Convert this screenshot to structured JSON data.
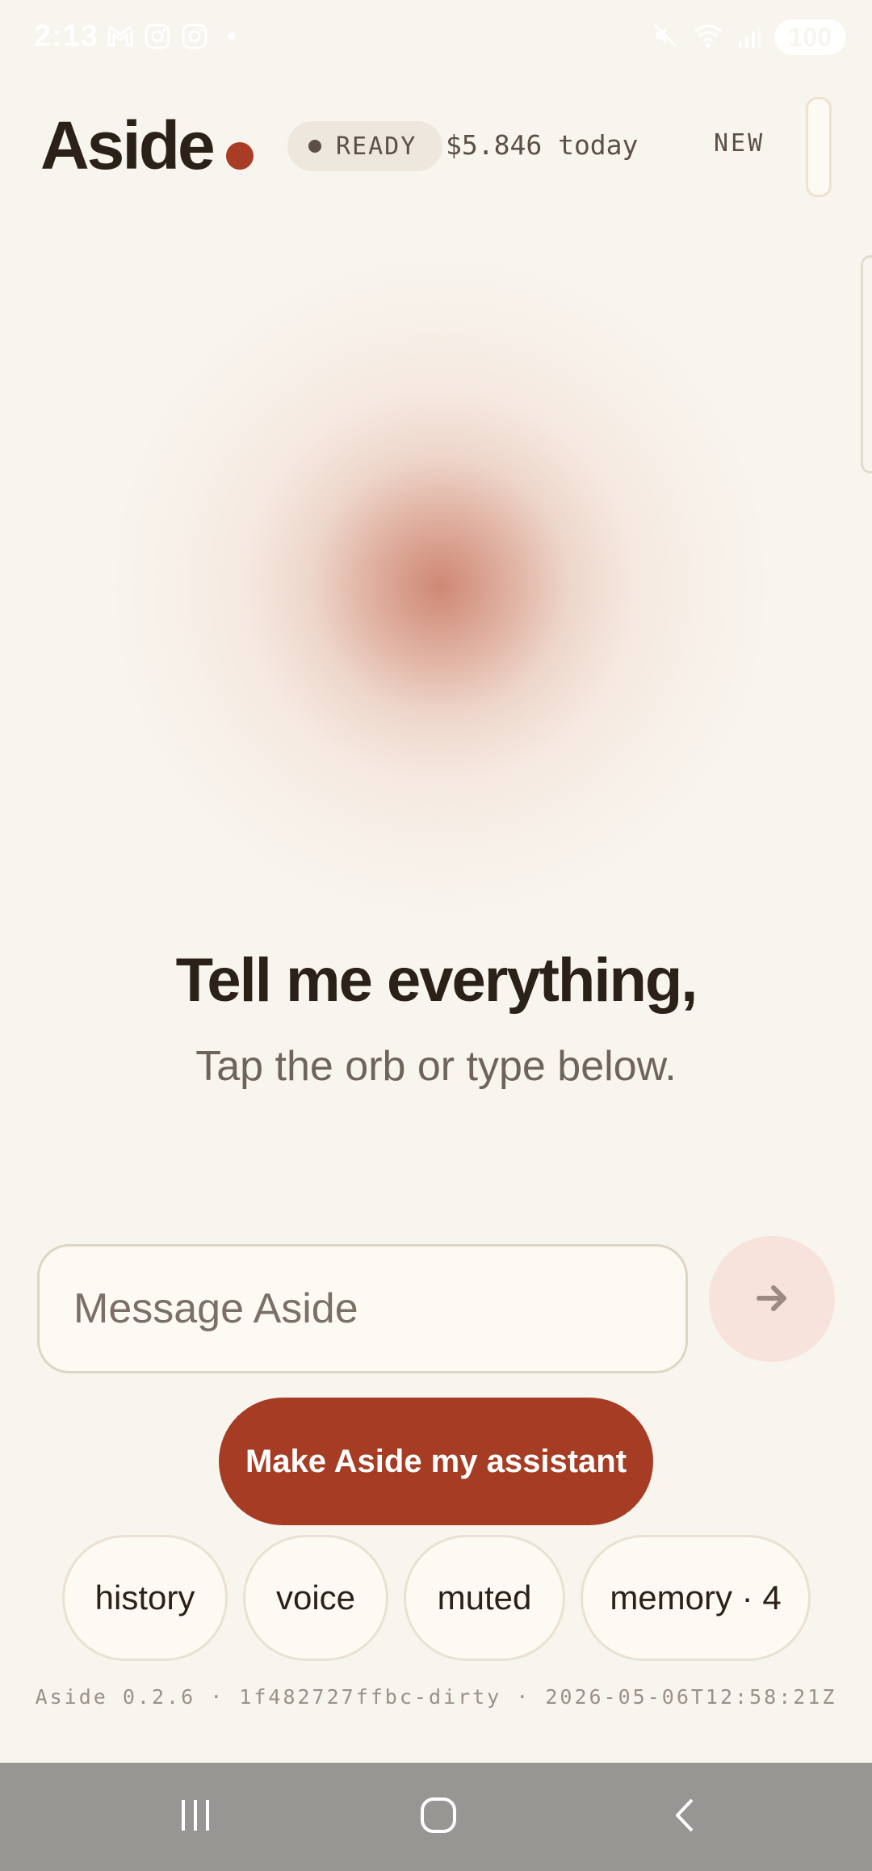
{
  "status_bar": {
    "time": "2:13",
    "battery": "100",
    "notification_icons": [
      "gmail-icon",
      "instagram-icon",
      "instagram-icon",
      "dot-icon"
    ],
    "system_icons": [
      "mute-icon",
      "wifi-icon",
      "signal-icon",
      "battery-icon"
    ]
  },
  "header": {
    "brand": "Aside",
    "status": "READY",
    "cost": "$5.846 today",
    "new_label": "NEW"
  },
  "hero": {
    "title": "Tell me everything,",
    "subtitle": "Tap the orb or type below."
  },
  "composer": {
    "placeholder": "Message Aside",
    "value": "",
    "send_icon": "arrow-right-icon"
  },
  "primary_action": {
    "label": "Make Aside my assistant"
  },
  "chips": [
    {
      "label": "history"
    },
    {
      "label": "voice"
    },
    {
      "label": "muted"
    },
    {
      "label": "memory · 4"
    }
  ],
  "build_info": "Aside 0.2.6 · 1f482727ffbc-dirty · 2026-05-06T12:58:21Z",
  "colors": {
    "background": "#f8f4ee",
    "accent": "#a63c24",
    "orb": "#cd826e",
    "text": "#2b2118",
    "muted_text": "#6f645b"
  }
}
